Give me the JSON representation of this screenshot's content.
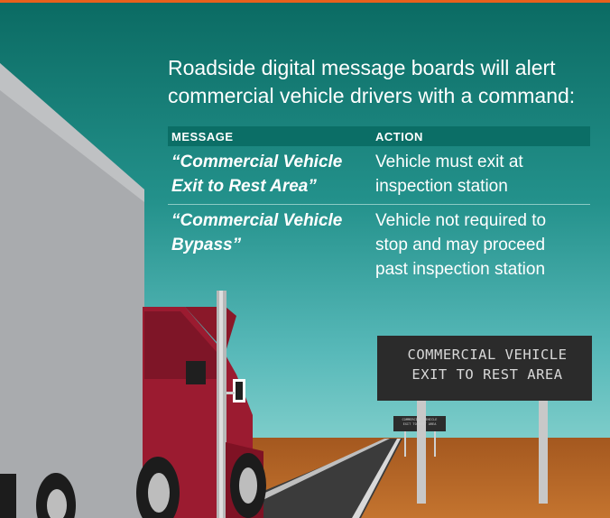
{
  "headline": {
    "line1": "Roadside digital message boards will alert",
    "line2": "commercial vehicle drivers with a command:"
  },
  "table": {
    "headers": {
      "message": "MESSAGE",
      "action": "ACTION"
    },
    "rows": [
      {
        "message_line1": "“Commercial Vehicle",
        "message_line2": "Exit to Rest Area”",
        "action_line1": "Vehicle must exit at",
        "action_line2": "inspection station",
        "action_line3": ""
      },
      {
        "message_line1": "“Commercial Vehicle",
        "message_line2": "Bypass”",
        "action_line1": "Vehicle not required to",
        "action_line2": "stop and may proceed",
        "action_line3": "past inspection station"
      }
    ]
  },
  "sign_large": {
    "line1": "COMMERCIAL VEHICLE",
    "line2": "EXIT TO REST AREA"
  },
  "sign_small": {
    "line1": "COMMERCIAL VEHICLE",
    "line2": "EXIT TO REST AREA"
  },
  "colors": {
    "sky_top": "#0b6e66",
    "sky_bottom": "#67c2c3",
    "ground": "#b8662a",
    "road": "#3c3c3c",
    "truck_cab": "#9b1b30",
    "trailer": "#a9abae",
    "sign_board": "#2b2b2b",
    "top_accent": "#e8601c"
  }
}
